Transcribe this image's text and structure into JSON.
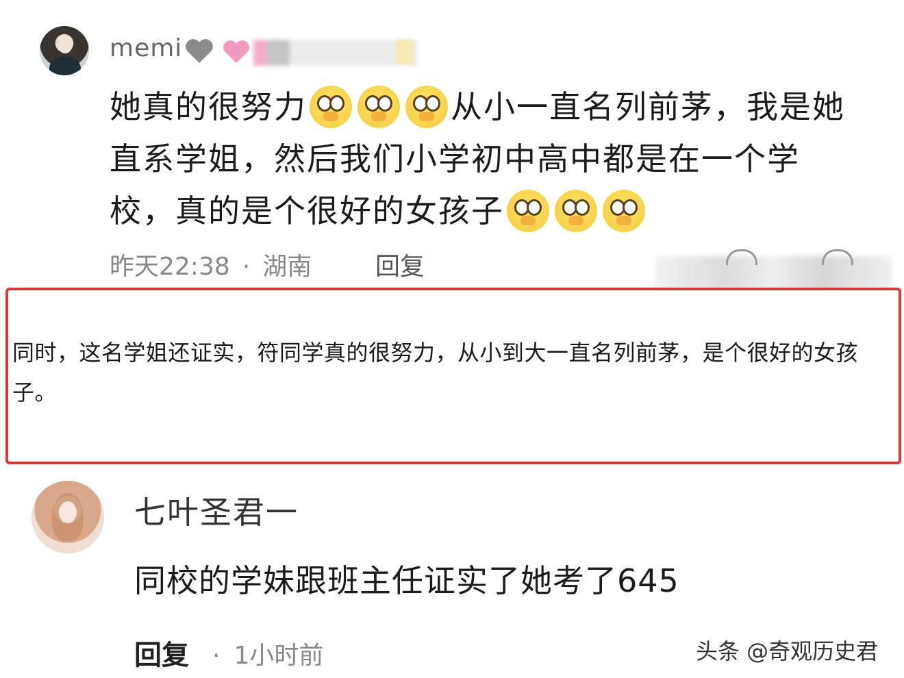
{
  "comment1": {
    "username": "memi",
    "text_part1": "她真的很努力",
    "text_part2": "从小一直名列前茅，我是她直系学姐，然后我们小学初中高中都是在一个学校，真的是个很好的女孩子",
    "emoji_name": "pleading-face-emoji",
    "time": "昨天22:38",
    "location": "湖南",
    "reply_label": "回复"
  },
  "note": {
    "text": "同时，这名学姐还证实，符同学真的很努力，从小到大一直名列前茅，是个很好的女孩子。"
  },
  "comment2": {
    "username": "七叶圣君一",
    "text": "同校的学妹跟班主任证实了她考了645",
    "reply_label": "回复",
    "time": "1小时前"
  },
  "watermark": "头条 @奇观历史君",
  "colors": {
    "highlight_border": "#d93838",
    "emoji_yellow": "#f4c93a"
  }
}
